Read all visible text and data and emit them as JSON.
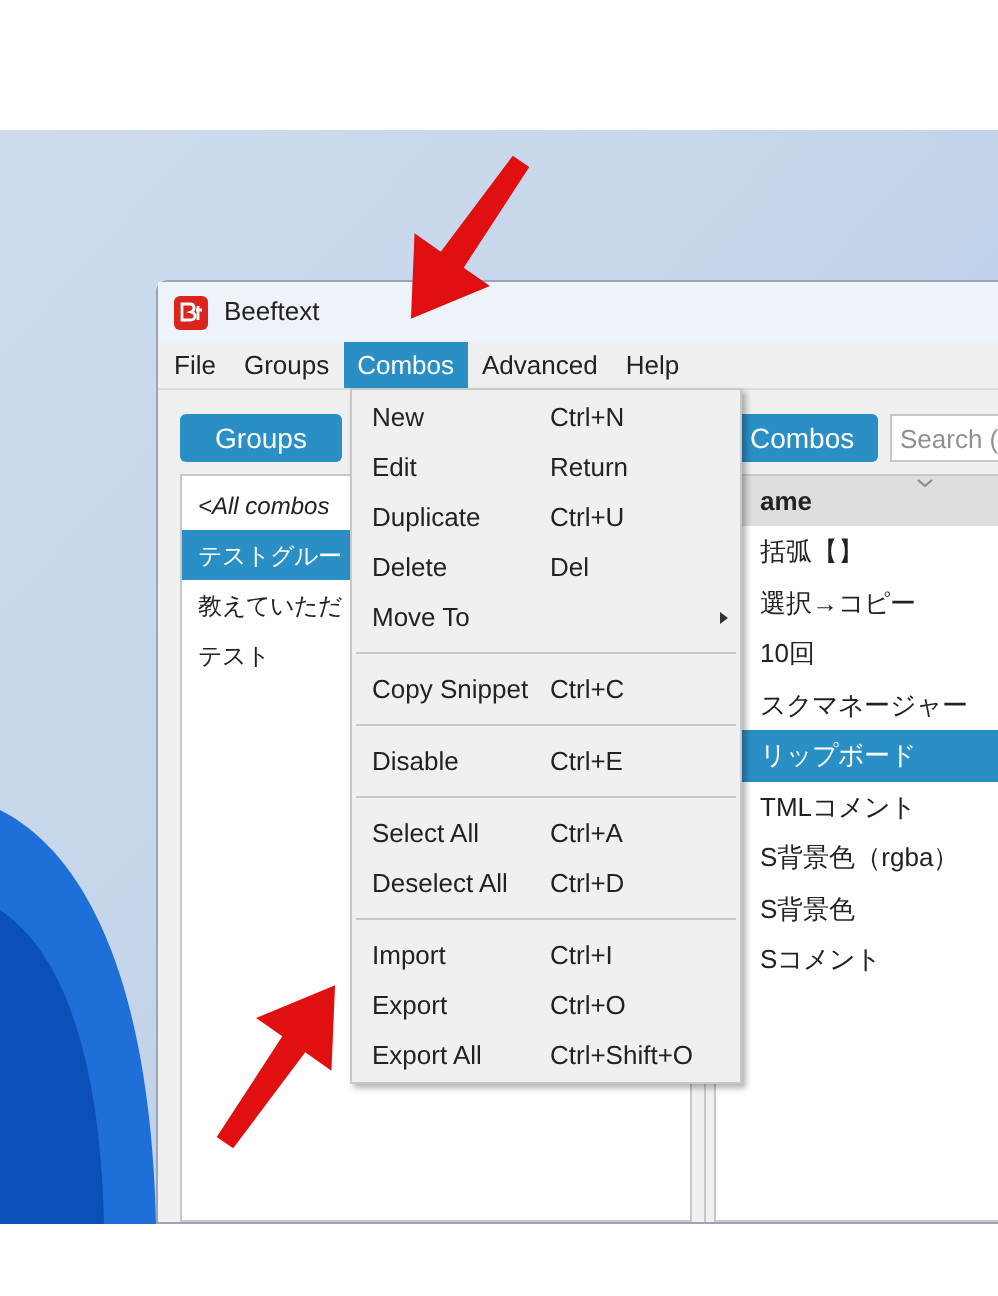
{
  "window": {
    "title": "Beeftext"
  },
  "menu_bar": [
    {
      "label": "File",
      "selected": false
    },
    {
      "label": "Groups",
      "selected": false
    },
    {
      "label": "Combos",
      "selected": true
    },
    {
      "label": "Advanced",
      "selected": false
    },
    {
      "label": "Help",
      "selected": false
    }
  ],
  "combos_menu": [
    {
      "kind": "item",
      "label": "New",
      "shortcut": "Ctrl+N"
    },
    {
      "kind": "item",
      "label": "Edit",
      "shortcut": "Return"
    },
    {
      "kind": "item",
      "label": "Duplicate",
      "shortcut": "Ctrl+U"
    },
    {
      "kind": "item",
      "label": "Delete",
      "shortcut": "Del"
    },
    {
      "kind": "submenu",
      "label": "Move To"
    },
    {
      "kind": "separator"
    },
    {
      "kind": "item",
      "label": "Copy Snippet",
      "shortcut": "Ctrl+C"
    },
    {
      "kind": "separator"
    },
    {
      "kind": "item",
      "label": "Disable",
      "shortcut": "Ctrl+E"
    },
    {
      "kind": "separator"
    },
    {
      "kind": "item",
      "label": "Select All",
      "shortcut": "Ctrl+A"
    },
    {
      "kind": "item",
      "label": "Deselect All",
      "shortcut": "Ctrl+D"
    },
    {
      "kind": "separator"
    },
    {
      "kind": "item",
      "label": "Import",
      "shortcut": "Ctrl+I"
    },
    {
      "kind": "item",
      "label": "Export",
      "shortcut": "Ctrl+O"
    },
    {
      "kind": "item",
      "label": "Export All",
      "shortcut": "Ctrl+Shift+O"
    }
  ],
  "groups_panel": {
    "button": "Groups",
    "items": [
      {
        "kind": "all",
        "label": "<All combos",
        "selected": false
      },
      {
        "kind": "group",
        "label": "テストグルー",
        "selected": true
      },
      {
        "kind": "group",
        "label": "教えていただ",
        "selected": false
      },
      {
        "kind": "group",
        "label": "テスト",
        "selected": false
      }
    ]
  },
  "combos_panel": {
    "button": "Combos",
    "search": {
      "placeholder": "Search ("
    },
    "column_1": "ame",
    "rows": [
      {
        "name": "括弧【】",
        "selected": false
      },
      {
        "name": "選択→コピー",
        "selected": false
      },
      {
        "name": "10回",
        "selected": false
      },
      {
        "name": "スクマネージャー",
        "selected": false
      },
      {
        "name": "リップボード",
        "selected": true
      },
      {
        "name": "TMLコメント",
        "selected": false
      },
      {
        "name": "S背景色（rgba）",
        "selected": false
      },
      {
        "name": "S背景色",
        "selected": false
      },
      {
        "name": "Sコメント",
        "selected": false
      }
    ]
  }
}
